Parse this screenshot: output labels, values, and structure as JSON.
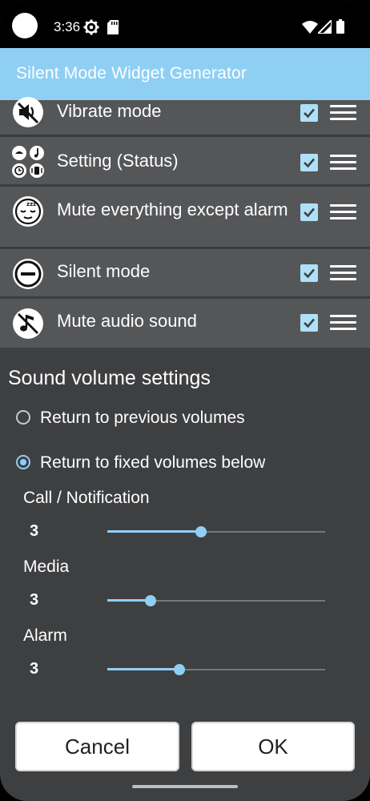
{
  "status_bar": {
    "time": "3:36",
    "icons": [
      "settings-gear-icon",
      "sd-card-icon",
      "wifi-icon",
      "cell-signal-icon",
      "battery-icon"
    ]
  },
  "app_bar": {
    "title": "Silent Mode Widget Generator"
  },
  "modes": [
    {
      "label": "Vibrate mode",
      "icon": "vibrate-mute-speaker-icon",
      "checked": true
    },
    {
      "label": "Setting (Status)",
      "icon": "status-grid-icon",
      "checked": true
    },
    {
      "label": "Mute everything except alarm",
      "icon": "sleep-face-icon",
      "checked": true
    },
    {
      "label": "Silent mode",
      "icon": "do-not-disturb-icon",
      "checked": true
    },
    {
      "label": "Mute audio sound",
      "icon": "music-off-icon",
      "checked": true
    }
  ],
  "sound_settings": {
    "title": "Sound volume settings",
    "options": [
      {
        "label": "Return to previous volumes",
        "selected": false
      },
      {
        "label": "Return to fixed volumes below",
        "selected": true
      }
    ],
    "volumes": [
      {
        "label": "Call / Notification",
        "value": "3",
        "level": 0.43
      },
      {
        "label": "Media",
        "value": "3",
        "level": 0.2
      },
      {
        "label": "Alarm",
        "value": "3",
        "level": 0.33
      }
    ]
  },
  "buttons": {
    "cancel": "Cancel",
    "ok": "OK"
  },
  "colors": {
    "accent": "#8fcff4",
    "background": "#3e3f41",
    "row": "#555658"
  }
}
